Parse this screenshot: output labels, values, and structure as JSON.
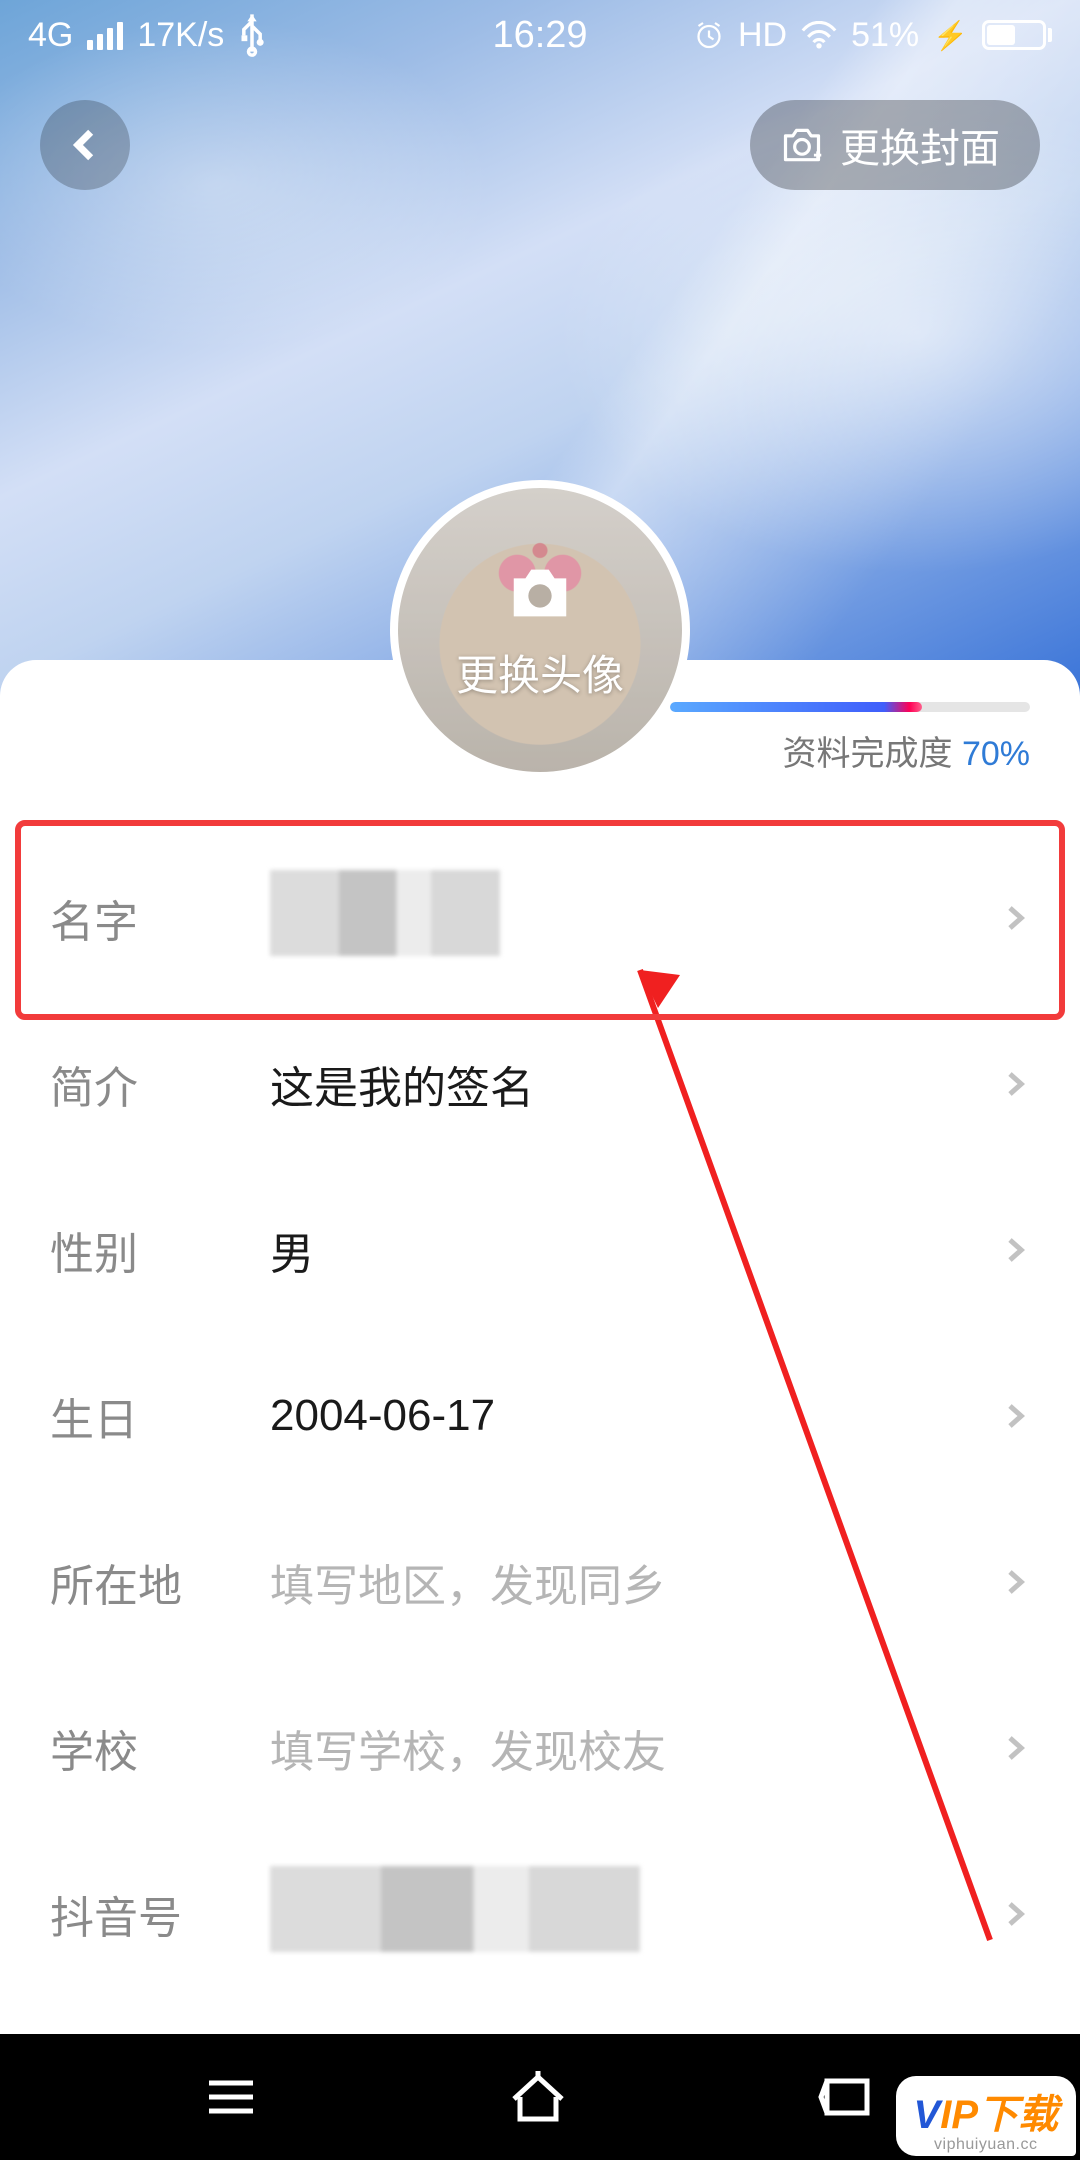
{
  "status": {
    "network": "4G",
    "speed": "17K/s",
    "time": "16:29",
    "hd": "HD",
    "battery_pct": "51%"
  },
  "header": {
    "change_cover_label": "更换封面",
    "change_avatar_label": "更换头像"
  },
  "progress": {
    "label_prefix": "资料完成度 ",
    "percent": "70%"
  },
  "rows": {
    "name": {
      "label": "名字"
    },
    "bio": {
      "label": "简介",
      "value": "这是我的签名"
    },
    "gender": {
      "label": "性别",
      "value": "男"
    },
    "birthday": {
      "label": "生日",
      "value": "2004-06-17"
    },
    "location": {
      "label": "所在地",
      "placeholder": "填写地区，发现同乡"
    },
    "school": {
      "label": "学校",
      "placeholder": "填写学校，发现校友"
    },
    "douyin_id": {
      "label": "抖音号"
    }
  },
  "watermark": {
    "brand_v": "V",
    "brand_rest": "IP",
    "brand_suffix": "下载",
    "url": "viphuiyuan.cc"
  }
}
